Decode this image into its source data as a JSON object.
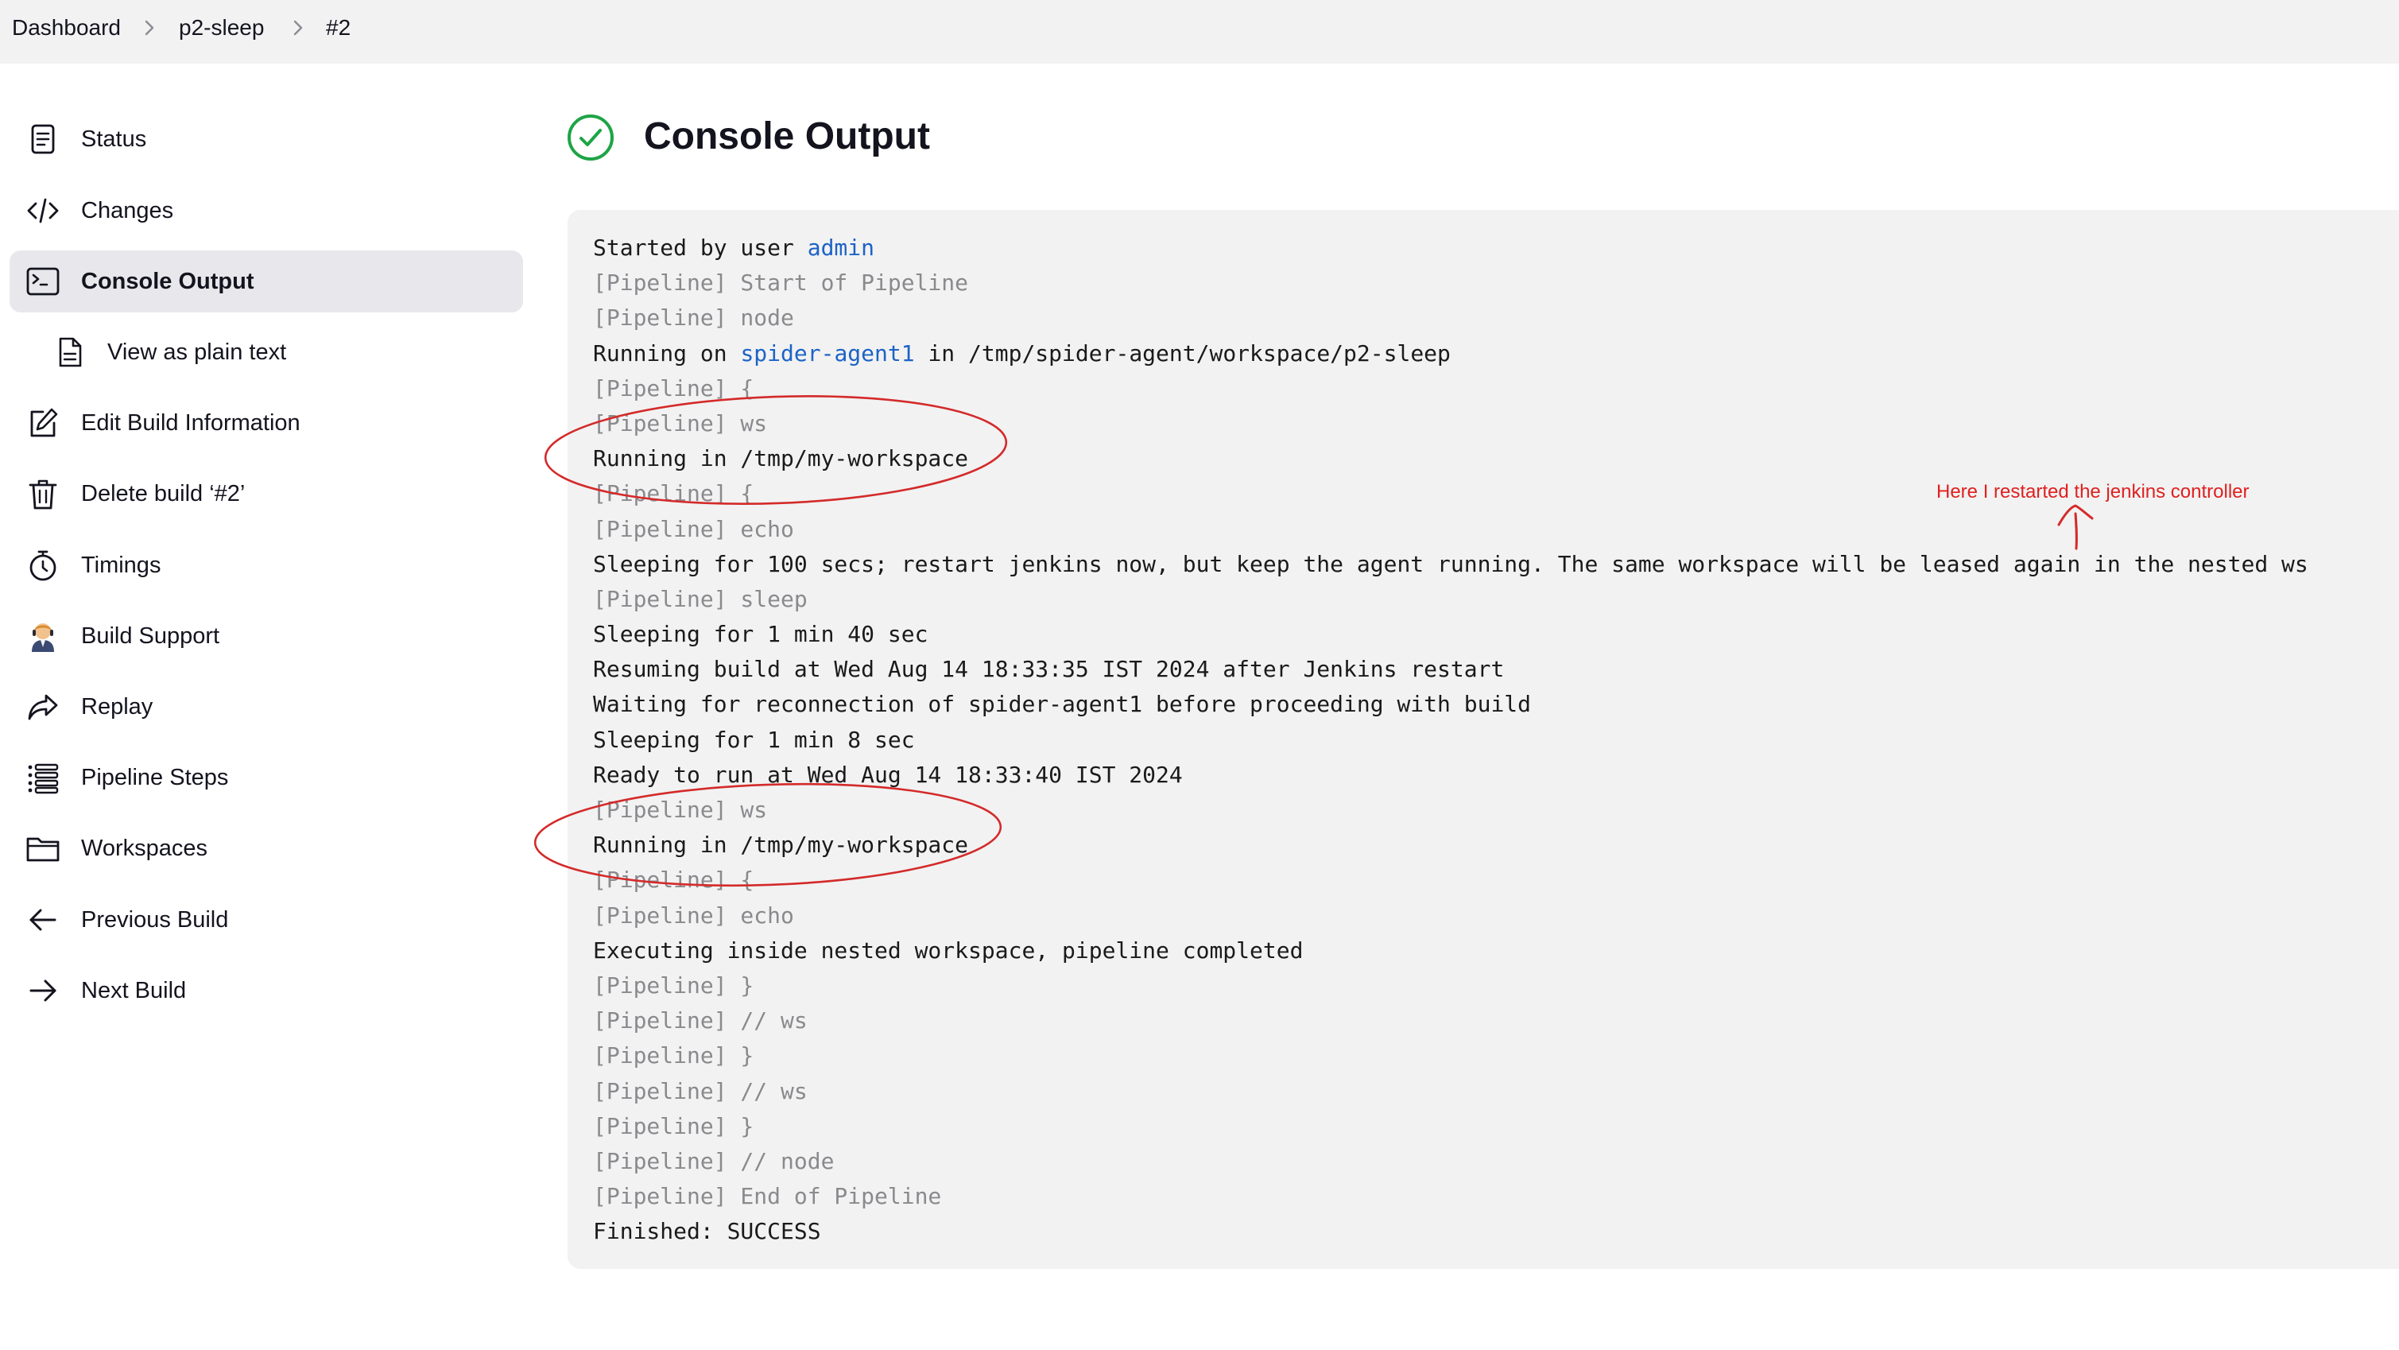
{
  "breadcrumb": {
    "items": [
      "Dashboard",
      "p2-sleep",
      "#2"
    ]
  },
  "sidebar": {
    "items": [
      {
        "label": "Status",
        "icon": "status-document-icon"
      },
      {
        "label": "Changes",
        "icon": "code-brackets-icon"
      },
      {
        "label": "Console Output",
        "icon": "terminal-icon",
        "active": true
      },
      {
        "label": "View as plain text",
        "icon": "document-icon",
        "sub": true
      },
      {
        "label": "Edit Build Information",
        "icon": "edit-note-icon"
      },
      {
        "label": "Delete build ‘#2’",
        "icon": "trash-icon"
      },
      {
        "label": "Timings",
        "icon": "stopwatch-icon"
      },
      {
        "label": "Build Support",
        "icon": "support-person-icon"
      },
      {
        "label": "Replay",
        "icon": "replay-arrow-icon"
      },
      {
        "label": "Pipeline Steps",
        "icon": "list-steps-icon"
      },
      {
        "label": "Workspaces",
        "icon": "folder-icon"
      },
      {
        "label": "Previous Build",
        "icon": "arrow-left-icon"
      },
      {
        "label": "Next Build",
        "icon": "arrow-right-icon"
      }
    ]
  },
  "main": {
    "title": "Console Output",
    "status_icon": "success-check-circle-icon",
    "status_color": "#1ea446",
    "console": {
      "lines": [
        {
          "text": "Started by user ",
          "link": "admin",
          "after": ""
        },
        {
          "text": "[Pipeline] Start of Pipeline",
          "kind": "pipeline"
        },
        {
          "text": "[Pipeline] node",
          "kind": "pipeline"
        },
        {
          "text": "Running on ",
          "link": "spider-agent1",
          "after": " in /tmp/spider-agent/workspace/p2-sleep"
        },
        {
          "text": "[Pipeline] {",
          "kind": "pipeline"
        },
        {
          "text": "[Pipeline] ws",
          "kind": "pipeline"
        },
        {
          "text": "Running in /tmp/my-workspace"
        },
        {
          "text": "[Pipeline] {",
          "kind": "pipeline"
        },
        {
          "text": "[Pipeline] echo",
          "kind": "pipeline"
        },
        {
          "text": "Sleeping for 100 secs; restart jenkins now, but keep the agent running. The same workspace will be leased again in the nested ws"
        },
        {
          "text": "[Pipeline] sleep",
          "kind": "pipeline"
        },
        {
          "text": "Sleeping for 1 min 40 sec"
        },
        {
          "text": "Resuming build at Wed Aug 14 18:33:35 IST 2024 after Jenkins restart"
        },
        {
          "text": "Waiting for reconnection of spider-agent1 before proceeding with build"
        },
        {
          "text": "Sleeping for 1 min 8 sec"
        },
        {
          "text": "Ready to run at Wed Aug 14 18:33:40 IST 2024"
        },
        {
          "text": "[Pipeline] ws",
          "kind": "pipeline"
        },
        {
          "text": "Running in /tmp/my-workspace"
        },
        {
          "text": "[Pipeline] {",
          "kind": "pipeline"
        },
        {
          "text": "[Pipeline] echo",
          "kind": "pipeline"
        },
        {
          "text": "Executing inside nested workspace, pipeline completed"
        },
        {
          "text": "[Pipeline] }",
          "kind": "pipeline"
        },
        {
          "text": "[Pipeline] // ws",
          "kind": "pipeline"
        },
        {
          "text": "[Pipeline] }",
          "kind": "pipeline"
        },
        {
          "text": "[Pipeline] // ws",
          "kind": "pipeline"
        },
        {
          "text": "[Pipeline] }",
          "kind": "pipeline"
        },
        {
          "text": "[Pipeline] // node",
          "kind": "pipeline"
        },
        {
          "text": "[Pipeline] End of Pipeline",
          "kind": "pipeline"
        },
        {
          "text": "Finished: SUCCESS"
        }
      ]
    }
  },
  "annotation": {
    "text": "Here I restarted the jenkins controller",
    "color": "#e02020"
  }
}
